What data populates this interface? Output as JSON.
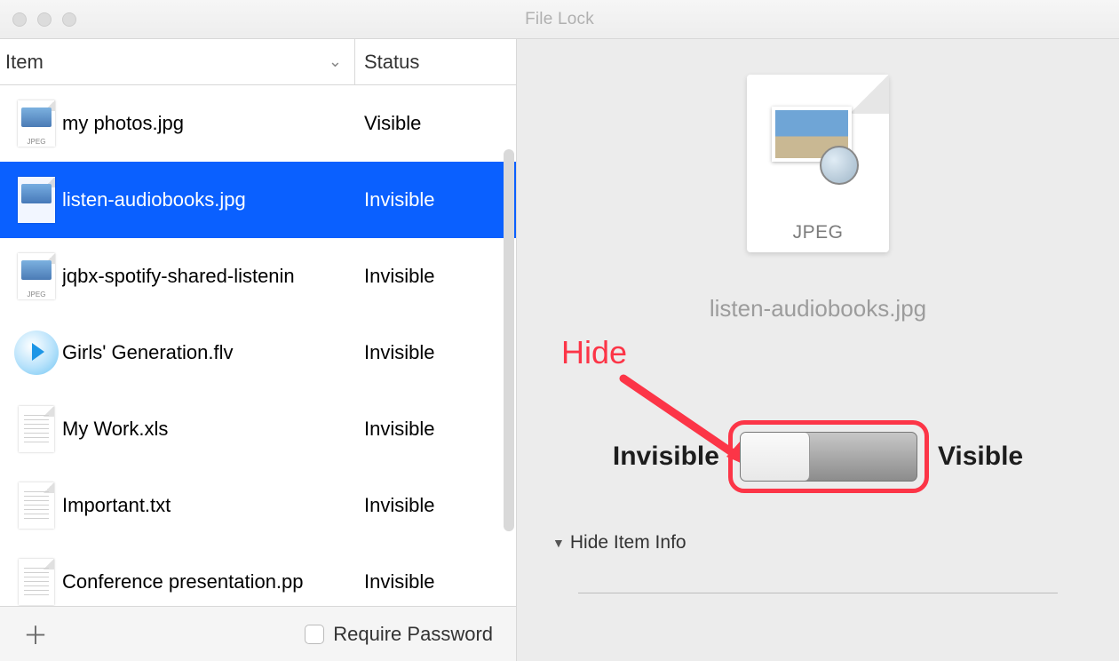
{
  "window": {
    "title": "File Lock"
  },
  "columns": {
    "item": "Item",
    "status": "Status"
  },
  "rows": [
    {
      "name": "my photos.jpg",
      "status": "Visible",
      "icon": "jpeg"
    },
    {
      "name": "listen-audiobooks.jpg",
      "status": "Invisible",
      "icon": "jpeg",
      "selected": true
    },
    {
      "name": "jqbx-spotify-shared-listenin",
      "status": "Invisible",
      "icon": "jpeg"
    },
    {
      "name": "Girls' Generation.flv",
      "status": "Invisible",
      "icon": "video"
    },
    {
      "name": "My Work.xls",
      "status": "Invisible",
      "icon": "doc"
    },
    {
      "name": "Important.txt",
      "status": "Invisible",
      "icon": "doc"
    },
    {
      "name": "Conference presentation.pp",
      "status": "Invisible",
      "icon": "doc"
    }
  ],
  "bottom": {
    "require_password_label": "Require Password"
  },
  "detail": {
    "file_type_label": "JPEG",
    "selected_filename": "listen-audiobooks.jpg",
    "invisible_label": "Invisible",
    "visible_label": "Visible",
    "hide_item_info_label": "Hide Item Info"
  },
  "annotation": {
    "hide_label": "Hide"
  },
  "colors": {
    "highlight": "#fc3547",
    "selection": "#0a60ff"
  }
}
